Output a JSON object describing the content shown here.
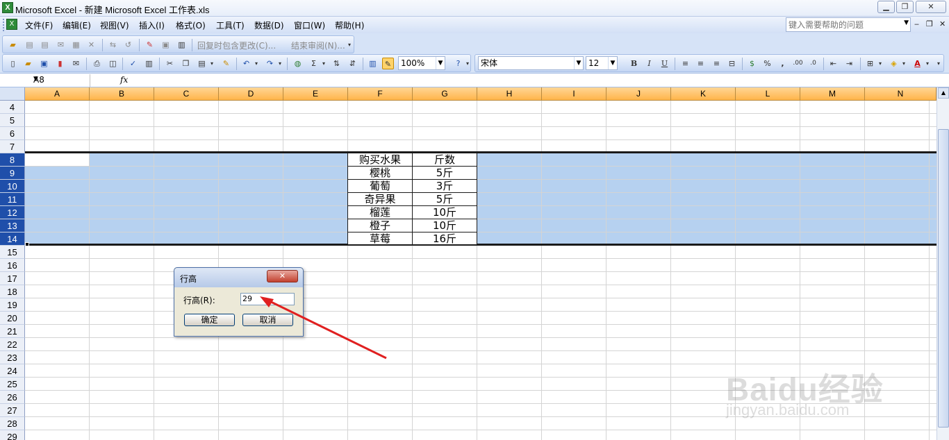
{
  "window": {
    "title": "Microsoft Excel - 新建 Microsoft Excel 工作表.xls",
    "minimize": "▁",
    "maximize": "❐",
    "close": "✕"
  },
  "menu": {
    "items": [
      "文件(F)",
      "编辑(E)",
      "视图(V)",
      "插入(I)",
      "格式(O)",
      "工具(T)",
      "数据(D)",
      "窗口(W)",
      "帮助(H)"
    ],
    "help_placeholder": "键入需要帮助的问题"
  },
  "review_toolbar": {
    "reply_label": "回复时包含更改(C)...",
    "end_review_label": "结束审阅(N)..."
  },
  "standard_toolbar": {
    "zoom": "100%",
    "font": "宋体",
    "font_size": "12"
  },
  "formula_bar": {
    "name_box": "A8",
    "fx": "fx",
    "content": ""
  },
  "columns": [
    "A",
    "B",
    "C",
    "D",
    "E",
    "F",
    "G",
    "H",
    "I",
    "J",
    "K",
    "L",
    "M",
    "N"
  ],
  "rows": [
    "4",
    "5",
    "6",
    "7",
    "8",
    "9",
    "10",
    "11",
    "12",
    "13",
    "14",
    "15",
    "16",
    "17",
    "18",
    "19",
    "20",
    "21",
    "22",
    "23",
    "24",
    "25",
    "26",
    "27",
    "28",
    "29"
  ],
  "selected_rows": [
    "8",
    "9",
    "10",
    "11",
    "12",
    "13",
    "14"
  ],
  "table": {
    "headers": [
      "购买水果",
      "斤数"
    ],
    "rows": [
      [
        "樱桃",
        "5斤"
      ],
      [
        "葡萄",
        "3斤"
      ],
      [
        "奇异果",
        "5斤"
      ],
      [
        "榴莲",
        "10斤"
      ],
      [
        "橙子",
        "10斤"
      ],
      [
        "草莓",
        "16斤"
      ]
    ]
  },
  "dialog": {
    "title": "行高",
    "label": "行高(R):",
    "value": "29",
    "ok": "确定",
    "cancel": "取消"
  },
  "watermark": {
    "text": "Baidu经验",
    "url": "jingyan.baidu.com"
  },
  "colors": {
    "selection": "#b6d1f0",
    "column_header": "#ffb44a",
    "selected_row_header": "#1f4faa",
    "annotation_arrow": "#e02020"
  }
}
